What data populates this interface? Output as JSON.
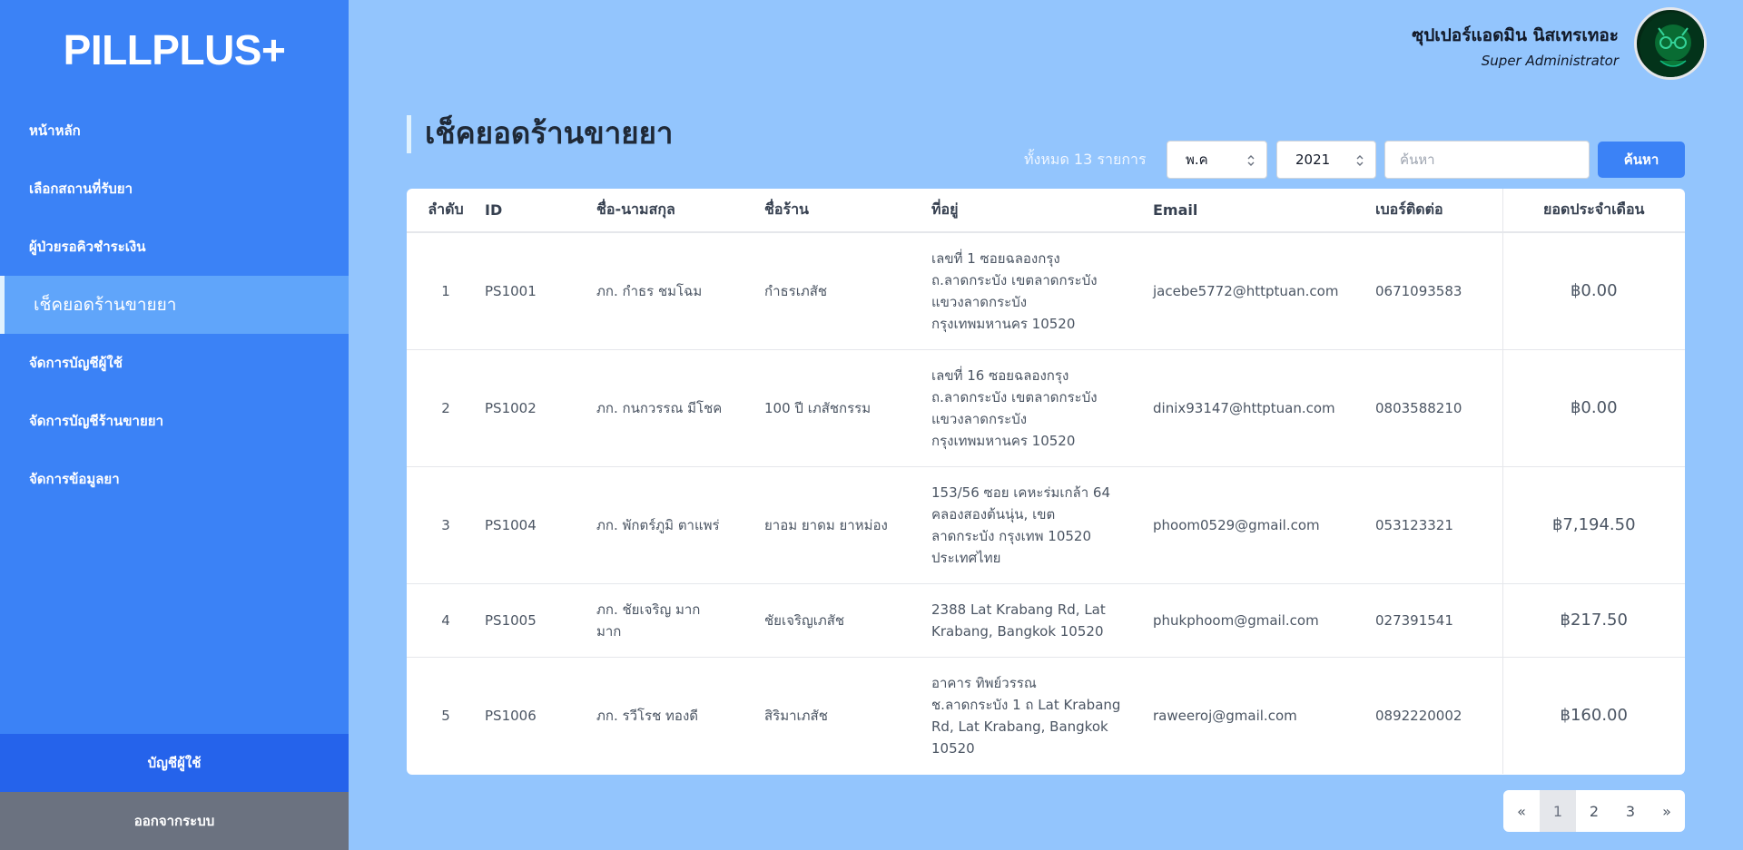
{
  "app": {
    "logo": "PILLPLUS+"
  },
  "sidebar": {
    "items": [
      {
        "label": "หน้าหลัก"
      },
      {
        "label": "เลือกสถานที่รับยา"
      },
      {
        "label": "ผู้ป่วยรอคิวชำระเงิน"
      },
      {
        "label": "เช็คยอดร้านขายยา"
      },
      {
        "label": "จัดการบัญชีผู้ใช้"
      },
      {
        "label": "จัดการบัญชีร้านขายยา"
      },
      {
        "label": "จัดการข้อมูลยา"
      }
    ],
    "active_index": 3,
    "account_label": "บัญชีผู้ใช้",
    "logout_label": "ออกจากระบบ"
  },
  "user": {
    "name": "ซุปเปอร์แอดมิน นิสเทรเทอะ",
    "role": "Super Administrator",
    "avatar_icon": "avatar-image"
  },
  "page": {
    "title": "เช็คยอดร้านขายยา"
  },
  "filters": {
    "total_label": "ทั้งหมด 13 รายการ",
    "month_value": "พ.ค",
    "year_value": "2021",
    "search_placeholder": "ค้นหา",
    "search_value": "",
    "search_button": "ค้นหา"
  },
  "table": {
    "headers": [
      "ลำดับ",
      "ID",
      "ชื่อ-นามสกุล",
      "ชื่อร้าน",
      "ที่อยู่",
      "Email",
      "เบอร์ติดต่อ",
      "ยอดประจำเดือน"
    ],
    "rows": [
      {
        "no": "1",
        "id": "PS1001",
        "name": "ภก. กำธร ชมโฉม",
        "shop": "กำธรเภสัช",
        "address": [
          "เลขที่ 1 ซอยฉลองกรุง",
          "ถ.ลาดกระบัง เขตลาดกระบัง",
          "แขวงลาดกระบัง",
          "กรุงเทพมหานคร 10520"
        ],
        "email": "jacebe5772@httptuan.com",
        "phone": "0671093583",
        "total": "฿0.00"
      },
      {
        "no": "2",
        "id": "PS1002",
        "name": "ภก. กนกวรรณ มีโชค",
        "shop": "100 ปี เภสัชกรรม",
        "address": [
          "เลขที่ 16 ซอยฉลองกรุง",
          "ถ.ลาดกระบัง เขตลาดกระบัง",
          "แขวงลาดกระบัง",
          "กรุงเทพมหานคร 10520"
        ],
        "email": "dinix93147@httptuan.com",
        "phone": "0803588210",
        "total": "฿0.00"
      },
      {
        "no": "3",
        "id": "PS1004",
        "name": "ภก. พักตร์ภูมิ ตาแพร่",
        "shop": "ยาอม ยาดม ยาหม่อง",
        "address": [
          "153/56 ซอย เคหะร่มเกล้า 64",
          "คลองสองต้นนุ่น, เขต",
          "ลาดกระบัง กรุงเทพ 10520",
          "ประเทศไทย"
        ],
        "email": "phoom0529@gmail.com",
        "phone": "053123321",
        "total": "฿7,194.50"
      },
      {
        "no": "4",
        "id": "PS1005",
        "name": [
          "ภก. ชัยเจริญ มาก",
          "มาก"
        ],
        "shop": "ชัยเจริญเภสัช",
        "address": [
          "2388 Lat Krabang Rd, Lat",
          "Krabang, Bangkok 10520"
        ],
        "email": "phukphoom@gmail.com",
        "phone": "027391541",
        "total": "฿217.50"
      },
      {
        "no": "5",
        "id": "PS1006",
        "name": "ภก. รวีโรช ทองดี",
        "shop": "สิริมาเภสัช",
        "address": [
          "อาคาร ทิพย์วรรณ",
          "ช.ลาดกระบัง 1 ถ Lat Krabang",
          "Rd, Lat Krabang, Bangkok",
          "10520"
        ],
        "email": "raweeroj@gmail.com",
        "phone": "0892220002",
        "total": "฿160.00"
      }
    ]
  },
  "pagination": {
    "prev": "«",
    "next": "»",
    "pages": [
      "1",
      "2",
      "3"
    ],
    "current": "1"
  },
  "colors": {
    "background": "#93c5fd",
    "sidebar": "#3b82f6",
    "sidebar_active": "#60a5fa",
    "account_button": "#2563eb",
    "logout_button": "#6b7280",
    "accent": "#3b82f6"
  }
}
